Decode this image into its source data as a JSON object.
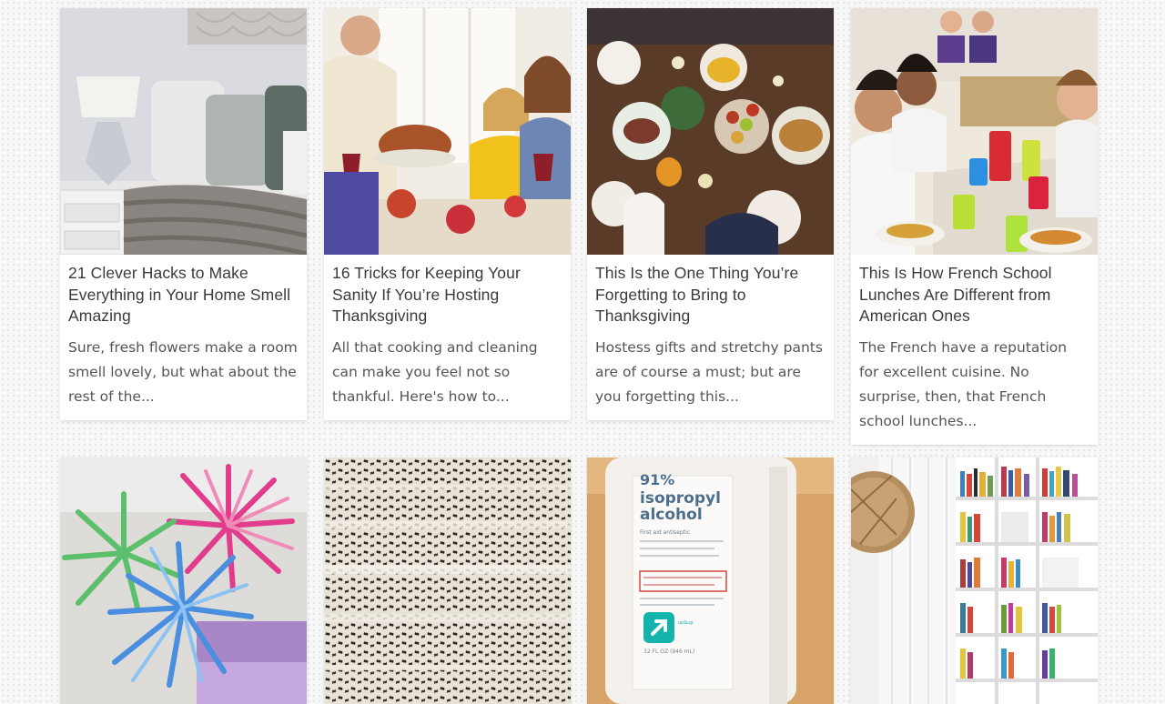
{
  "cards": [
    {
      "title": "21 Clever Hacks to Make Everything in Your Home Smell Amazing",
      "description": "Sure, fresh flowers make a room smell lovely, but what about the rest of the...",
      "image": "bedroom-lamp-photo"
    },
    {
      "title": "16 Tricks for Keeping Your Sanity If You’re Hosting Thanksgiving",
      "description": "All that cooking and cleaning can make you feel not so thankful. Here's how to...",
      "image": "family-turkey-dinner-photo"
    },
    {
      "title": "This Is the One Thing You’re Forgetting to Bring to Thanksgiving",
      "description": "Hostess gifts and stretchy pants are of course a must; but are you forgetting this...",
      "image": "thanksgiving-table-overhead-photo"
    },
    {
      "title": "This Is How French School Lunches Are Different from American Ones",
      "description": "The French have a reputation for excellent cuisine. No surprise, then, that French school lunches...",
      "image": "school-cafeteria-kids-photo"
    },
    {
      "image": "paper-fireworks-craft-photo"
    },
    {
      "image": "ants-on-wood-photo"
    },
    {
      "image": "isopropyl-alcohol-bottle-photo",
      "image_text": {
        "percent": "91%",
        "line1": "isopropyl",
        "line2": "alcohol",
        "subtitle": "First aid antiseptic",
        "brand": "up&up",
        "volume": "32 FL OZ (946 mL)"
      }
    },
    {
      "image": "bookshelf-room-photo"
    }
  ]
}
